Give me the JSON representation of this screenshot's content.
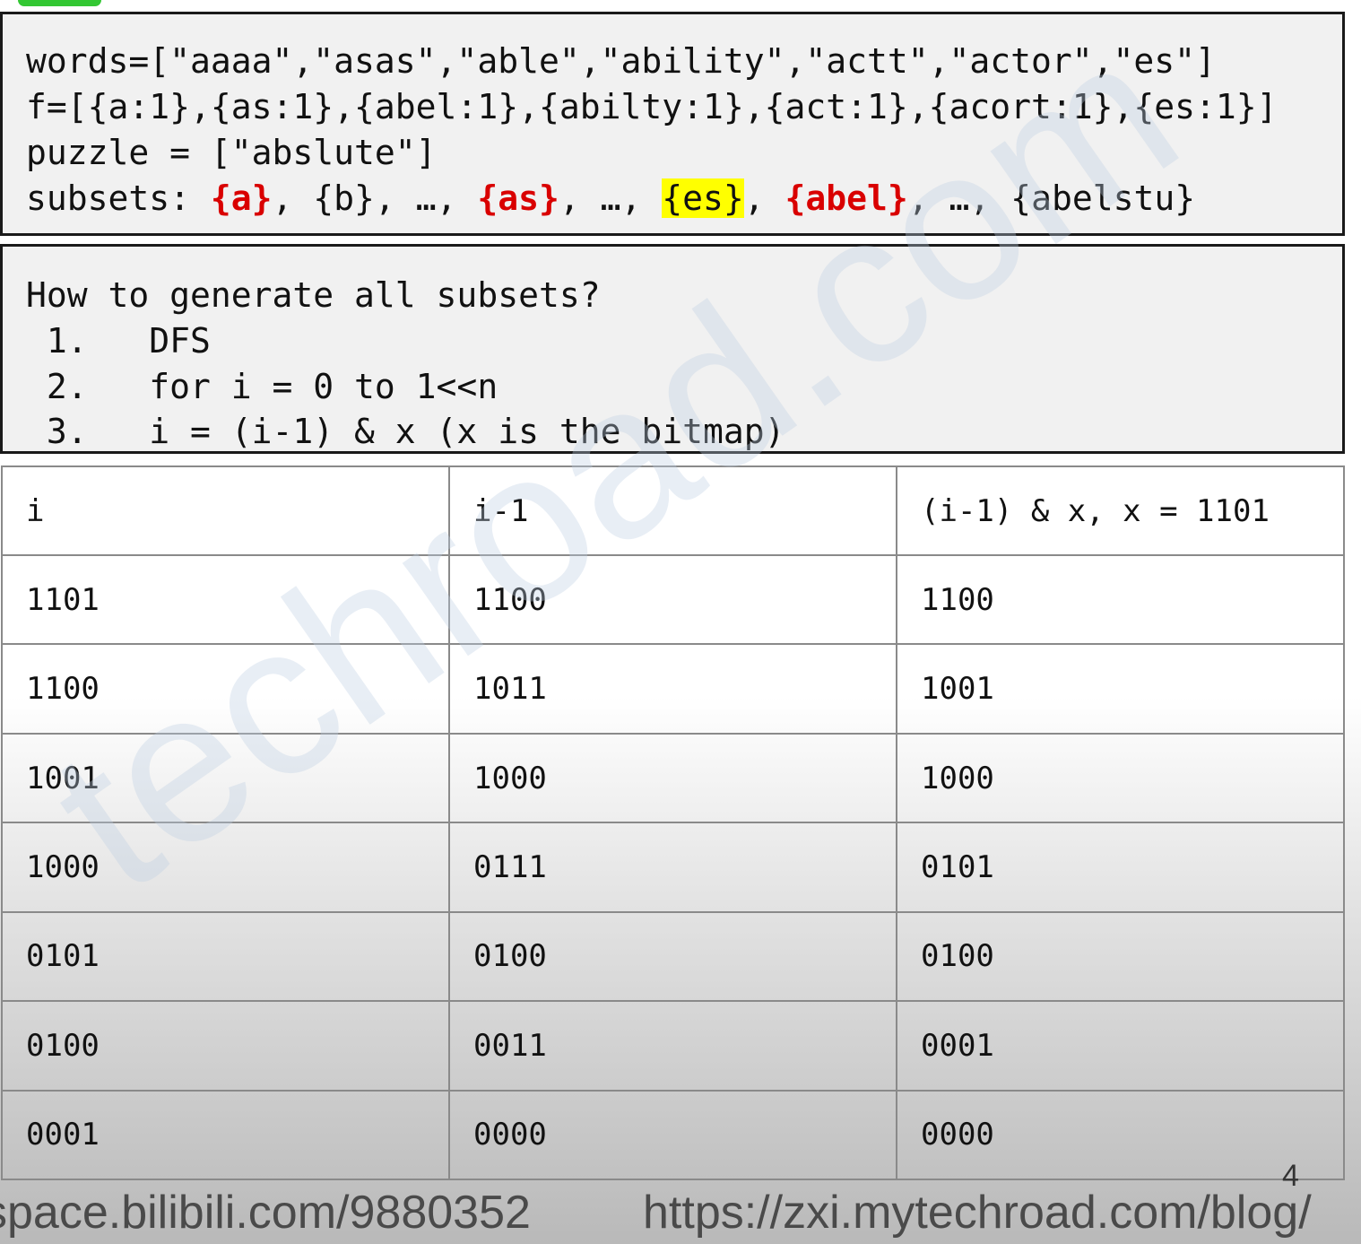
{
  "box1": {
    "line1": "words=[\"aaaa\",\"asas\",\"able\",\"ability\",\"actt\",\"actor\",\"es\"]",
    "line2": "f=[{a:1},{as:1},{abel:1},{abilty:1},{act:1},{acort:1},{es:1}]",
    "line3": "puzzle = [\"abslute\"]",
    "subsets_label": "subsets: ",
    "s_a": "{a}",
    "s_b": ", {b}, …, ",
    "s_as": "{as}",
    "s_dots1": ", …, ",
    "s_es": "{es}",
    "s_comma": ", ",
    "s_abel": "{abel}",
    "s_rest": ", …, {abelstu}"
  },
  "box2": {
    "line1": "How to generate all subsets?",
    "line2": " 1.   DFS",
    "line3": " 2.   for i = 0 to 1<<n",
    "line4": " 3.   i = (i-1) & x (x is the bitmap)"
  },
  "table": {
    "headers": [
      "i",
      "i-1",
      "(i-1) & x,  x = 1101"
    ],
    "rows": [
      [
        "1101",
        "1100",
        "1100"
      ],
      [
        "1100",
        "1011",
        "1001"
      ],
      [
        "1001",
        "1000",
        "1000"
      ],
      [
        "1000",
        "0111",
        "0101"
      ],
      [
        "0101",
        "0100",
        "0100"
      ],
      [
        "0100",
        "0011",
        "0001"
      ],
      [
        "0001",
        "0000",
        "0000"
      ]
    ]
  },
  "watermark": "techroad.com",
  "page_number": "4",
  "footer": {
    "left": "space.bilibili.com/9880352",
    "right": "https://zxi.mytechroad.com/blog/"
  },
  "colors": {
    "highlight_red": "#d90000",
    "highlight_yellow": "#ffff00",
    "tab_green": "#33c733"
  }
}
